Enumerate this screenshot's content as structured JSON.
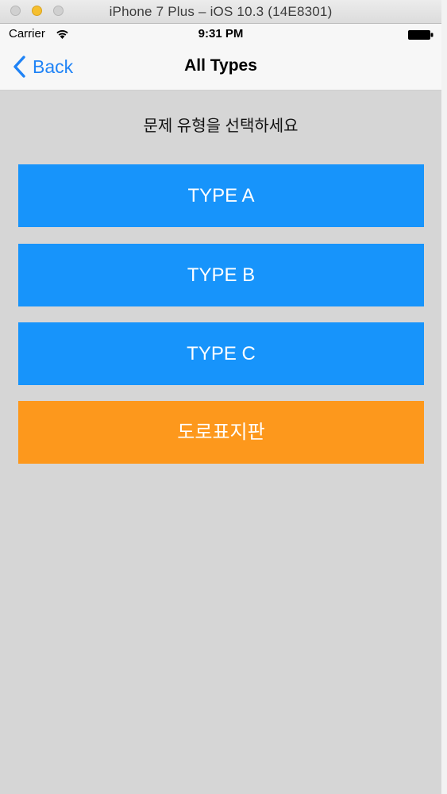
{
  "window": {
    "title": "iPhone 7 Plus – iOS 10.3 (14E8301)"
  },
  "status_bar": {
    "carrier": "Carrier",
    "time": "9:31 PM",
    "icons": [
      "wifi-icon",
      "battery-icon"
    ]
  },
  "nav_bar": {
    "back_label": "Back",
    "title": "All Types"
  },
  "main": {
    "prompt": "문제 유형을 선택하세요",
    "buttons": [
      {
        "label": "TYPE A",
        "color": "#1794fb"
      },
      {
        "label": "TYPE B",
        "color": "#1794fb"
      },
      {
        "label": "TYPE C",
        "color": "#1794fb"
      },
      {
        "label": "도로표지판",
        "color": "#fd981c"
      }
    ]
  },
  "colors": {
    "ios_blue": "#1f83f6",
    "background": "#d6d6d6"
  }
}
